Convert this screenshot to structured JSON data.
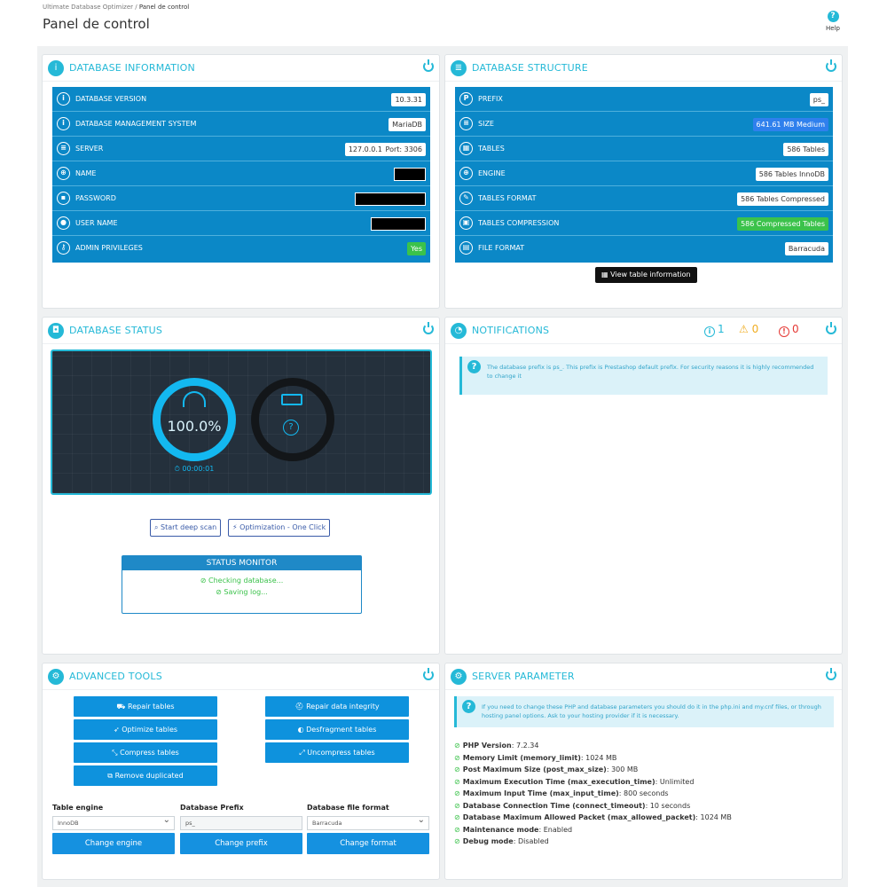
{
  "breadcrumb": {
    "parent": "Ultimate Database Optimizer",
    "current": "Panel de control"
  },
  "page_title": "Panel de control",
  "help_label": "Help",
  "db_info": {
    "title": "DATABASE INFORMATION",
    "rows": [
      {
        "label": "DATABASE VERSION",
        "value": "10.3.31",
        "icon": "info-icon"
      },
      {
        "label": "DATABASE MANAGEMENT SYSTEM",
        "value": "MariaDB",
        "icon": "info-icon"
      },
      {
        "label": "SERVER",
        "value": "127.0.0.1",
        "value2": "Port: 3306",
        "icon": "server-icon"
      },
      {
        "label": "NAME",
        "icon": "globe-icon"
      },
      {
        "label": "PASSWORD",
        "icon": "lock-icon"
      },
      {
        "label": "USER NAME",
        "icon": "user-icon"
      },
      {
        "label": "ADMIN PRIVILEGES",
        "value": "Yes",
        "icon": "key-icon"
      }
    ]
  },
  "db_structure": {
    "title": "DATABASE STRUCTURE",
    "rows": [
      {
        "label": "PREFIX",
        "value": "ps_",
        "icon": "prefix-icon"
      },
      {
        "label": "SIZE",
        "value": "641.61 MB Medium",
        "icon": "database-icon"
      },
      {
        "label": "TABLES",
        "value": "586 Tables",
        "icon": "table-icon"
      },
      {
        "label": "ENGINE",
        "value": "586 Tables InnoDB",
        "icon": "engine-icon"
      },
      {
        "label": "TABLES FORMAT",
        "value": "586 Tables Compressed",
        "icon": "wrench-icon"
      },
      {
        "label": "TABLES COMPRESSION",
        "value": "586 Compressed Tables",
        "icon": "compress-icon"
      },
      {
        "label": "FILE FORMAT",
        "value": "Barracuda",
        "icon": "file-icon"
      }
    ],
    "view_button": "View table information"
  },
  "db_status": {
    "title": "DATABASE STATUS",
    "percent": "100.0%",
    "progress": 1.0,
    "timer": "00:00:01",
    "unknown": "?",
    "deep_scan": "Start deep scan",
    "optimize": "Optimization - One Click",
    "monitor_title": "STATUS MONITOR",
    "monitor_lines": [
      "Checking database...",
      "Saving log..."
    ]
  },
  "notifications": {
    "title": "NOTIFICATIONS",
    "info_count": "1",
    "warn_count": "0",
    "error_count": "0",
    "message": "The database prefix is ps_. This prefix is Prestashop default prefix. For security reasons it is highly recommended to change it"
  },
  "tools": {
    "title": "ADVANCED TOOLS",
    "buttons": [
      "Repair tables",
      "Repair data integrity",
      "Optimize tables",
      "Desfragment tables",
      "Compress tables",
      "Uncompress tables",
      "Remove duplicated"
    ],
    "engine_label": "Table engine",
    "engine_value": "InnoDB",
    "engine_btn": "Change engine",
    "prefix_label": "Database Prefix",
    "prefix_value": "ps_",
    "prefix_btn": "Change prefix",
    "format_label": "Database file format",
    "format_value": "Barracuda",
    "format_btn": "Change format"
  },
  "server": {
    "title": "SERVER PARAMETER",
    "message": "If you need to change these PHP and database parameters you should do it in the php.ini and my.cnf files, or through hosting panel options. Ask to your hosting provider if it is necessary.",
    "params": [
      {
        "k": "PHP Version",
        "v": "7.2.34"
      },
      {
        "k": "Memory Limit (memory_limit)",
        "v": "1024 MB"
      },
      {
        "k": "Post Maximum Size (post_max_size)",
        "v": "300 MB"
      },
      {
        "k": "Maximum Execution Time (max_execution_time)",
        "v": "Unlimited"
      },
      {
        "k": "Maximum Input Time (max_input_time)",
        "v": "800 seconds"
      },
      {
        "k": "Database Connection Time (connect_timeout)",
        "v": "10 seconds"
      },
      {
        "k": "Database Maximum Allowed Packet (max_allowed_packet)",
        "v": "1024 MB"
      },
      {
        "k": "Maintenance mode",
        "v": "Enabled"
      },
      {
        "k": "Debug mode",
        "v": "Disabled"
      }
    ]
  },
  "colors": {
    "accent": "#25b9d7",
    "table_blue": "#0b88c7",
    "success": "#3bc24b",
    "warning": "#f0ad22",
    "danger": "#e53935"
  }
}
